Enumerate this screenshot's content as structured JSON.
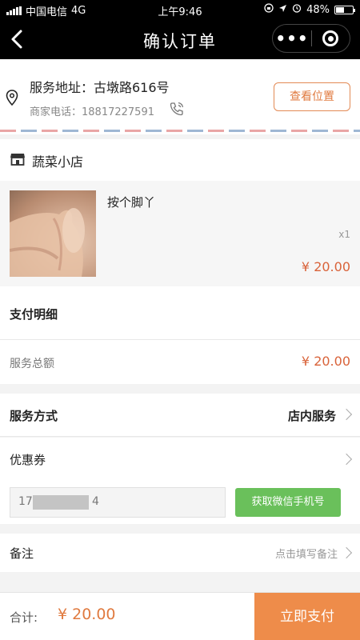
{
  "status_bar": {
    "carrier": "中国电信",
    "network": "4G",
    "time": "上午9:46",
    "battery": "48%",
    "battery_level": 0.48
  },
  "nav": {
    "title": "确认订单",
    "more": "•••"
  },
  "address": {
    "service_address": "服务地址：古墩路616号",
    "merchant_phone": "商家电话：18817227591",
    "view_location_button": "查看位置"
  },
  "store": {
    "name": "蔬菜小店"
  },
  "product": {
    "name": "按个脚丫",
    "quantity": "x1",
    "price": "¥ 20.00"
  },
  "payment_detail": {
    "title": "支付明细",
    "total_label": "服务总额",
    "total_value": "¥ 20.00"
  },
  "service_method": {
    "label": "服务方式",
    "value": "店内服务"
  },
  "coupon": {
    "label": "优惠券"
  },
  "phone_binding": {
    "visible_prefix": "17",
    "visible_suffix": "4",
    "get_wechat_phone_button": "获取微信手机号"
  },
  "remark": {
    "label": "备注",
    "hint": "点击填写备注"
  },
  "footer": {
    "total_label": "合计:",
    "total_value": "¥ 20.00",
    "pay_button": "立即支付"
  },
  "colors": {
    "accent_orange": "#e07a3f",
    "pay_button": "#ee8c4a",
    "wechat_green": "#6ac05b"
  }
}
